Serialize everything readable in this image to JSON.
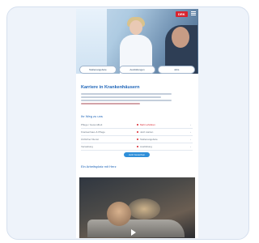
{
  "hero": {
    "logo_text": "DRK",
    "buttons": [
      {
        "label": "Stellenangebote"
      },
      {
        "label": "Ausbildungen"
      },
      {
        "label": "Jobs"
      }
    ]
  },
  "main": {
    "headline": "Karriere in Krankenhäusern",
    "section_title": "Ihr Weg zu uns",
    "table": [
      {
        "left": "Pflege / Gesundheit",
        "right": "Mehr erfahren"
      },
      {
        "left": "Krankenhaus & Pflege",
        "right": "Jetzt starten"
      },
      {
        "left": "Ärztlicher Dienst",
        "right": "Stellenangebote"
      },
      {
        "left": "Verwaltung",
        "right": "Ausbildung"
      }
    ],
    "cta_label": "Jetzt bewerben",
    "subsection_title": "Ein Arbeitsplatz mit Herz"
  },
  "colors": {
    "brand_red": "#d9232e",
    "link_blue": "#1d64b8",
    "cta_blue": "#2f8fd9"
  },
  "icons": {
    "menu": "hamburger-icon",
    "row_bullet": "dot-icon",
    "row_chevron": "chevron-right-icon",
    "video_play": "play-icon"
  }
}
